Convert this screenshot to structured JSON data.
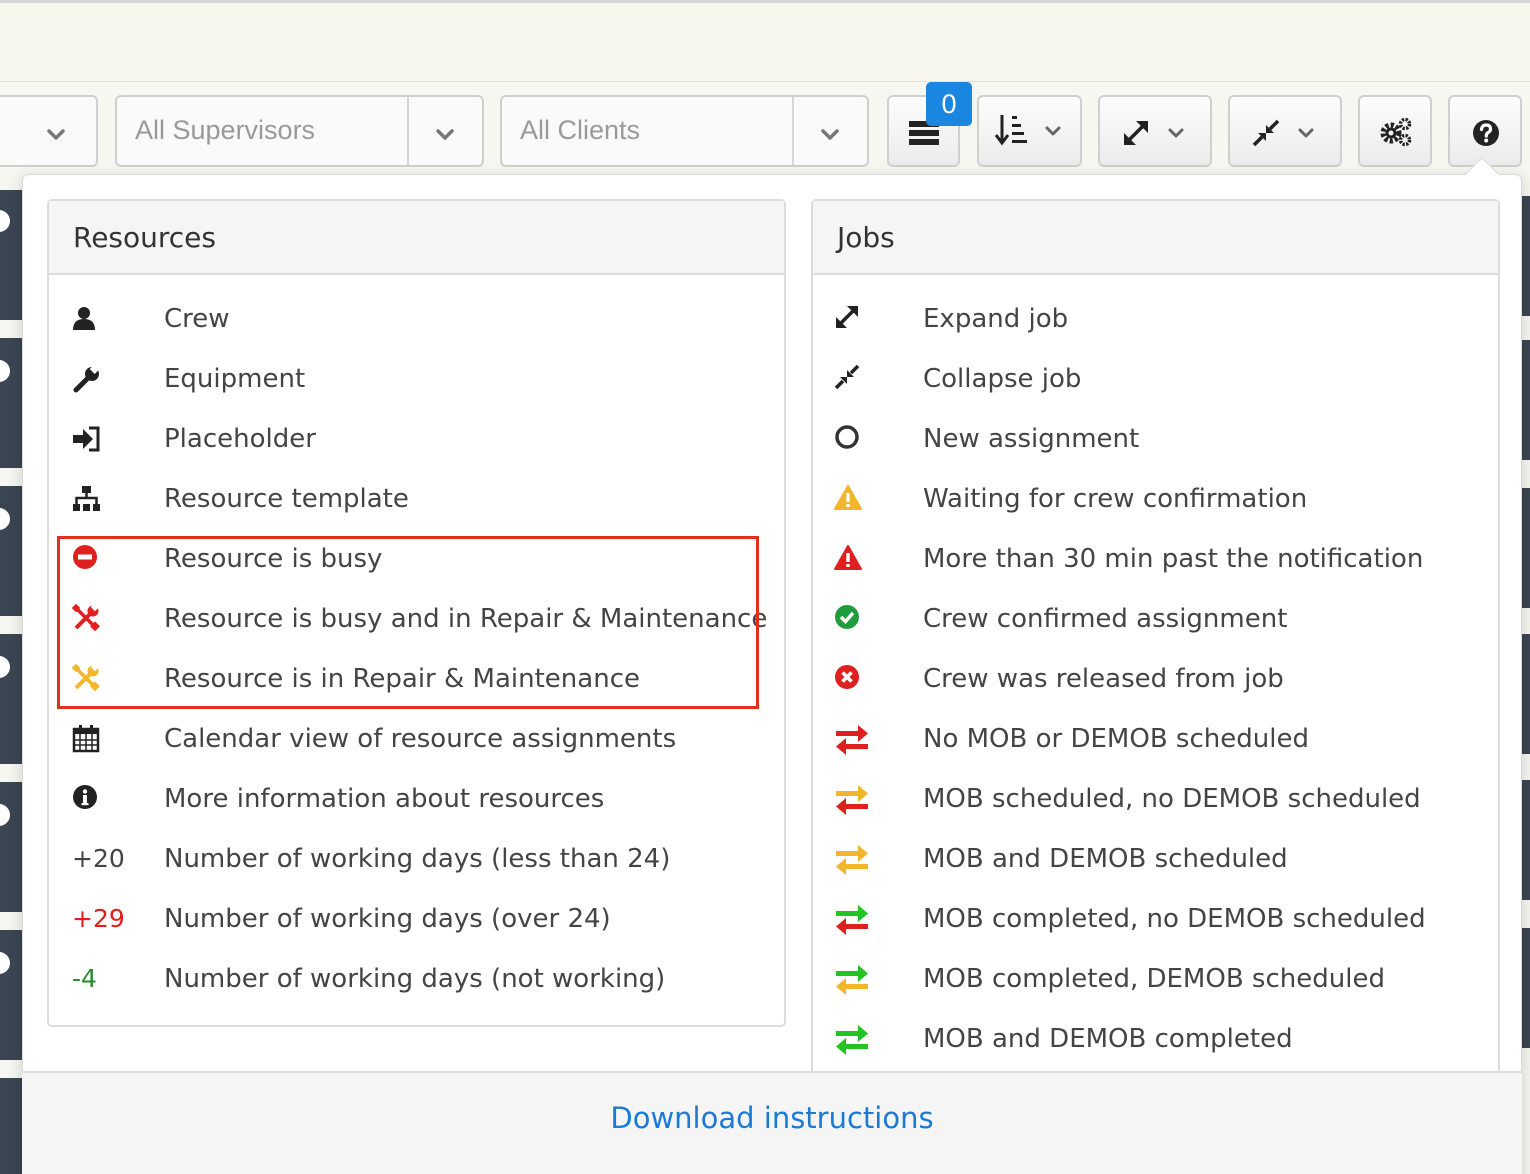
{
  "toolbar": {
    "supervisors_select": {
      "selected": "All Supervisors"
    },
    "clients_select": {
      "selected": "All Clients"
    },
    "badge_count": "0",
    "icons": [
      "list-icon",
      "sort-icon",
      "expand-icon",
      "collapse-icon",
      "cogs-icon",
      "help-icon"
    ]
  },
  "resources": {
    "title": "Resources",
    "items": [
      {
        "icon": "user-icon",
        "label": "Crew"
      },
      {
        "icon": "wrench-icon",
        "label": "Equipment"
      },
      {
        "icon": "sign-in-icon",
        "label": "Placeholder"
      },
      {
        "icon": "sitemap-icon",
        "label": "Resource template"
      },
      {
        "icon": "minus-circle-icon",
        "label": "Resource is busy",
        "color": "#e0201e"
      },
      {
        "icon": "tools-icon",
        "label": "Resource is busy and in Repair & Maintenance",
        "color": "#e0201e"
      },
      {
        "icon": "tools-icon",
        "label": "Resource is in Repair & Maintenance",
        "color": "#f3b52a"
      },
      {
        "icon": "calendar-icon",
        "label": "Calendar view of resource assignments"
      },
      {
        "icon": "info-circle-icon",
        "label": "More information about resources"
      },
      {
        "prefix": "+20",
        "label": "Number of working days (less than 24)",
        "color": "#444444"
      },
      {
        "prefix": "+29",
        "label": "Number of working days (over 24)",
        "color": "#e0201e"
      },
      {
        "prefix": "-4",
        "label": "Number of working days (not working)",
        "color": "#2a8a2a"
      }
    ]
  },
  "jobs": {
    "title": "Jobs",
    "items": [
      {
        "icon": "expand-icon",
        "label": "Expand job"
      },
      {
        "icon": "compress-icon",
        "label": "Collapse job"
      },
      {
        "icon": "circle-outline-icon",
        "label": "New assignment"
      },
      {
        "icon": "warning-icon",
        "label": "Waiting for crew confirmation",
        "color": "#f3b52a"
      },
      {
        "icon": "warning-icon",
        "label": "More than 30 min past the notification",
        "color": "#e0201e"
      },
      {
        "icon": "check-circle-icon",
        "label": "Crew confirmed assignment",
        "color": "#1f9d3c"
      },
      {
        "icon": "times-circle-icon",
        "label": "Crew was released from job",
        "color": "#e0201e"
      },
      {
        "icon": "exchange-icon",
        "label": "No MOB or DEMOB scheduled",
        "colors": [
          "#e0201e",
          "#e0201e"
        ]
      },
      {
        "icon": "exchange-icon",
        "label": "MOB scheduled, no DEMOB scheduled",
        "colors": [
          "#f3b52a",
          "#e0201e"
        ]
      },
      {
        "icon": "exchange-icon",
        "label": "MOB and DEMOB scheduled",
        "colors": [
          "#f3b52a",
          "#f3b52a"
        ]
      },
      {
        "icon": "exchange-icon",
        "label": "MOB completed, no DEMOB scheduled",
        "colors": [
          "#22c322",
          "#e0201e"
        ]
      },
      {
        "icon": "exchange-icon",
        "label": "MOB completed, DEMOB scheduled",
        "colors": [
          "#22c322",
          "#f3b52a"
        ]
      },
      {
        "icon": "exchange-icon",
        "label": "MOB and DEMOB completed",
        "colors": [
          "#22c322",
          "#22c322"
        ]
      }
    ]
  },
  "footer": {
    "link": "Download instructions"
  }
}
